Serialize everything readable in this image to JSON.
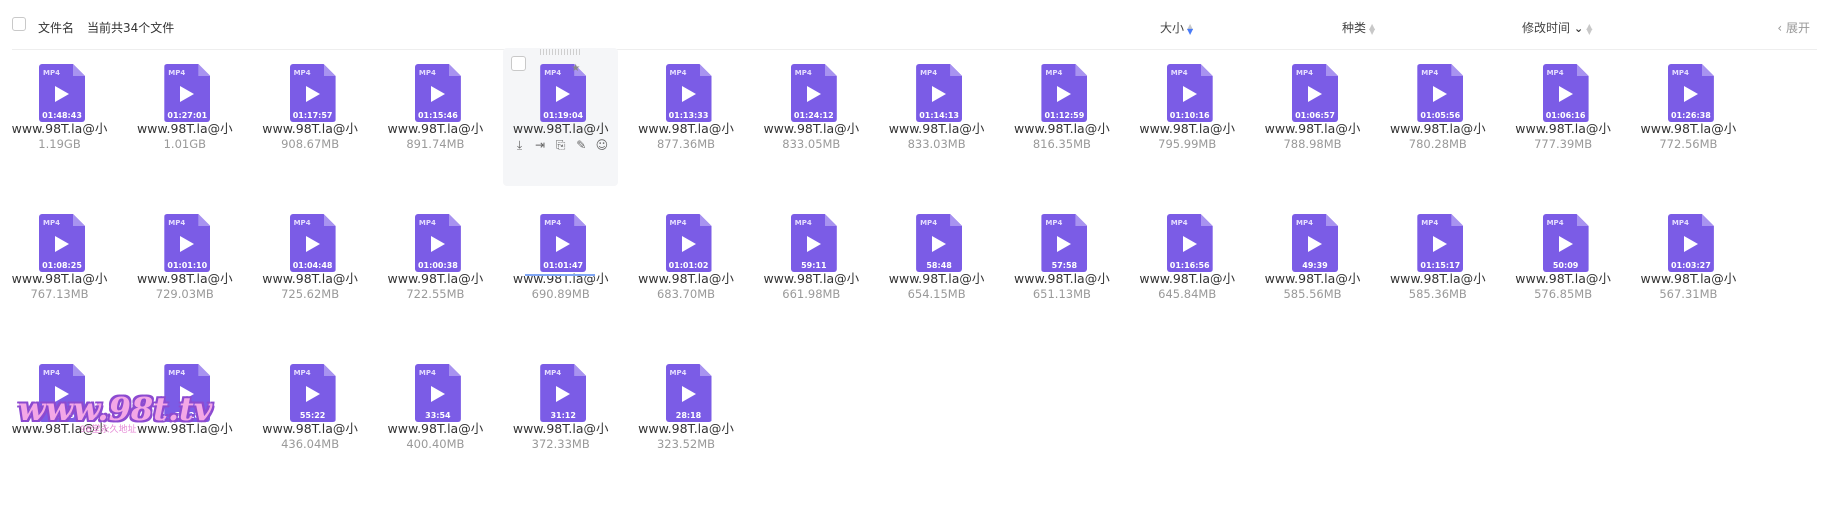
{
  "header": {
    "name_label": "文件名",
    "count_text": "当前共34个文件",
    "size_label": "大小",
    "type_label": "种类",
    "modified_label": "修改时间",
    "collapse_label": "展开"
  },
  "files": [
    {
      "name": "www.98T.la@小",
      "size": "1.19GB",
      "duration": "01:48:43"
    },
    {
      "name": "www.98T.la@小",
      "size": "1.01GB",
      "duration": "01:27:01"
    },
    {
      "name": "www.98T.la@小",
      "size": "908.67MB",
      "duration": "01:17:57"
    },
    {
      "name": "www.98T.la@小",
      "size": "891.74MB",
      "duration": "01:15:46"
    },
    {
      "name": "www.98T.la@小",
      "size": "",
      "duration": "01:19:04"
    },
    {
      "name": "www.98T.la@小",
      "size": "877.36MB",
      "duration": "01:13:33"
    },
    {
      "name": "www.98T.la@小",
      "size": "833.05MB",
      "duration": "01:24:12"
    },
    {
      "name": "www.98T.la@小",
      "size": "833.03MB",
      "duration": "01:14:13"
    },
    {
      "name": "www.98T.la@小",
      "size": "816.35MB",
      "duration": "01:12:59"
    },
    {
      "name": "www.98T.la@小",
      "size": "795.99MB",
      "duration": "01:10:16"
    },
    {
      "name": "www.98T.la@小",
      "size": "788.98MB",
      "duration": "01:06:57"
    },
    {
      "name": "www.98T.la@小",
      "size": "780.28MB",
      "duration": "01:05:56"
    },
    {
      "name": "www.98T.la@小",
      "size": "777.39MB",
      "duration": "01:06:16"
    },
    {
      "name": "www.98T.la@小",
      "size": "772.56MB",
      "duration": "01:26:38"
    },
    {
      "name": "www.98T.la@小",
      "size": "767.13MB",
      "duration": "01:08:25"
    },
    {
      "name": "www.98T.la@小",
      "size": "729.03MB",
      "duration": "01:01:10"
    },
    {
      "name": "www.98T.la@小",
      "size": "725.62MB",
      "duration": "01:04:48"
    },
    {
      "name": "www.98T.la@小",
      "size": "722.55MB",
      "duration": "01:00:38"
    },
    {
      "name": "www.98T.la@小",
      "size": "690.89MB",
      "duration": "01:01:47"
    },
    {
      "name": "www.98T.la@小",
      "size": "683.70MB",
      "duration": "01:01:02"
    },
    {
      "name": "www.98T.la@小",
      "size": "661.98MB",
      "duration": "59:11"
    },
    {
      "name": "www.98T.la@小",
      "size": "654.15MB",
      "duration": "58:48"
    },
    {
      "name": "www.98T.la@小",
      "size": "651.13MB",
      "duration": "57:58"
    },
    {
      "name": "www.98T.la@小",
      "size": "645.84MB",
      "duration": "01:16:56"
    },
    {
      "name": "www.98T.la@小",
      "size": "585.56MB",
      "duration": "49:39"
    },
    {
      "name": "www.98T.la@小",
      "size": "585.36MB",
      "duration": "01:15:17"
    },
    {
      "name": "www.98T.la@小",
      "size": "576.85MB",
      "duration": "50:09"
    },
    {
      "name": "www.98T.la@小",
      "size": "567.31MB",
      "duration": "01:03:27"
    },
    {
      "name": "www.98T.la@小",
      "size": "",
      "duration": "45:55"
    },
    {
      "name": "www.98T.la@小",
      "size": "",
      "duration": "56:28"
    },
    {
      "name": "www.98T.la@小",
      "size": "436.04MB",
      "duration": "55:22"
    },
    {
      "name": "www.98T.la@小",
      "size": "400.40MB",
      "duration": "33:54"
    },
    {
      "name": "www.98T.la@小",
      "size": "372.33MB",
      "duration": "31:12"
    },
    {
      "name": "www.98T.la@小",
      "size": "323.52MB",
      "duration": "28:18"
    }
  ],
  "file_ext": "MP4",
  "hovered_index": 4,
  "focused_index": 18,
  "hover_actions": [
    "download-icon",
    "move-icon",
    "share-icon",
    "edit-icon",
    "more-icon"
  ],
  "colors": {
    "file_icon": "#7b5ce6",
    "sort_active": "#4a7cf7"
  },
  "watermark": {
    "text": "www.98t.tv",
    "subtext": "98堂永久地址"
  }
}
